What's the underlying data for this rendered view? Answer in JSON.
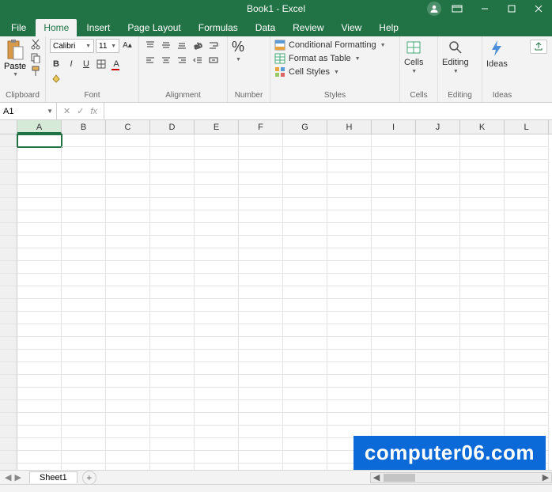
{
  "title": "Book1 - Excel",
  "tabs": [
    "File",
    "Home",
    "Insert",
    "Page Layout",
    "Formulas",
    "Data",
    "Review",
    "View",
    "Help"
  ],
  "active_tab": "Home",
  "ribbon": {
    "clipboard": {
      "paste": "Paste",
      "label": "Clipboard"
    },
    "font": {
      "name": "Calibri",
      "size": "11",
      "label": "Font",
      "bold": "B",
      "italic": "I",
      "underline": "U",
      "a_letter": "A"
    },
    "alignment": {
      "label": "Alignment"
    },
    "number": {
      "label": "Number",
      "symbol": "%"
    },
    "styles": {
      "label": "Styles",
      "conditional": "Conditional Formatting",
      "table": "Format as Table",
      "cell": "Cell Styles"
    },
    "cells": {
      "label": "Cells",
      "btn": "Cells"
    },
    "editing": {
      "label": "Editing",
      "btn": "Editing"
    },
    "ideas": {
      "label": "Ideas",
      "btn": "Ideas"
    }
  },
  "namebox": "A1",
  "formula_fx": "fx",
  "columns": [
    "A",
    "B",
    "C",
    "D",
    "E",
    "F",
    "G",
    "H",
    "I",
    "J",
    "K",
    "L"
  ],
  "active_cell": "A1",
  "sheet": "Sheet1",
  "watermark": "computer06.com"
}
